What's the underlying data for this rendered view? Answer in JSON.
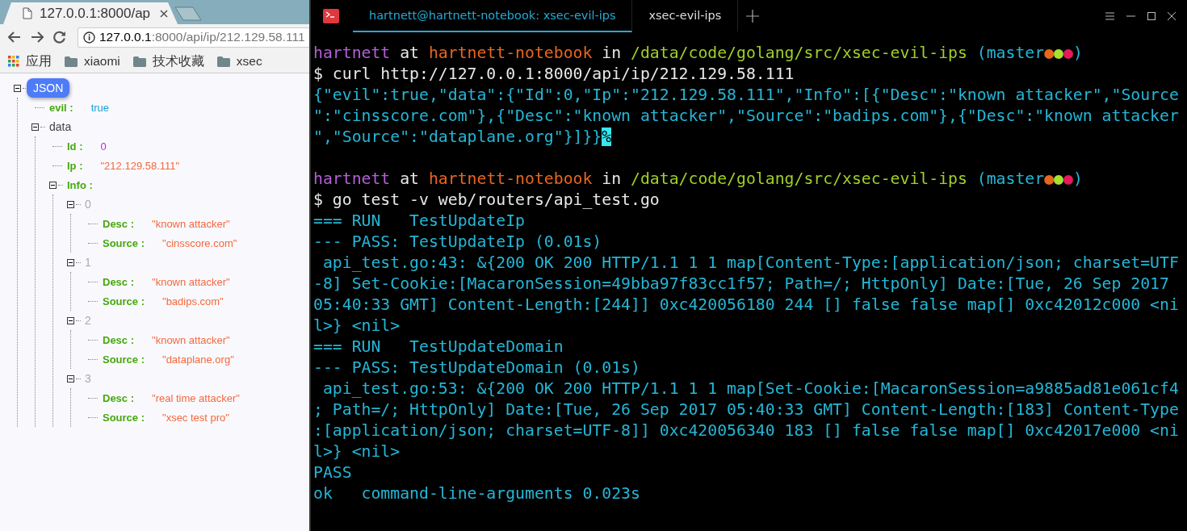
{
  "browser": {
    "tabs": [
      {
        "title": "127.0.0.1:8000/ap",
        "selected": true
      }
    ],
    "address": {
      "host": "127.0.0.1",
      "path": ":8000/api/ip/212.129.58.111"
    },
    "bookmarks": [
      {
        "label": "应用",
        "kind": "apps"
      },
      {
        "label": "xiaomi",
        "kind": "folder"
      },
      {
        "label": "技术收藏",
        "kind": "folder"
      },
      {
        "label": "xsec",
        "kind": "folder"
      }
    ],
    "tree": {
      "root": "JSON",
      "expanded": true,
      "children": [
        {
          "label": "evil :",
          "kind": "boolean",
          "value": "true"
        },
        {
          "label": "data",
          "kind": "object",
          "expanded": true,
          "children": [
            {
              "label": "Id :",
              "kind": "number",
              "value": "0"
            },
            {
              "label": "Ip :",
              "kind": "string",
              "value": "\"212.129.58.111\""
            },
            {
              "label": "Info :",
              "kind": "array",
              "expanded": true,
              "children": [
                {
                  "label": "0",
                  "kind": "index",
                  "expanded": true,
                  "children": [
                    {
                      "label": "Desc :",
                      "kind": "string",
                      "value": "\"known attacker\""
                    },
                    {
                      "label": "Source :",
                      "kind": "string",
                      "value": "\"cinsscore.com\""
                    }
                  ]
                },
                {
                  "label": "1",
                  "kind": "index",
                  "expanded": true,
                  "children": [
                    {
                      "label": "Desc :",
                      "kind": "string",
                      "value": "\"known attacker\""
                    },
                    {
                      "label": "Source :",
                      "kind": "string",
                      "value": "\"badips.com\""
                    }
                  ]
                },
                {
                  "label": "2",
                  "kind": "index",
                  "expanded": true,
                  "children": [
                    {
                      "label": "Desc :",
                      "kind": "string",
                      "value": "\"known attacker\""
                    },
                    {
                      "label": "Source :",
                      "kind": "string",
                      "value": "\"dataplane.org\""
                    }
                  ]
                },
                {
                  "label": "3",
                  "kind": "index",
                  "expanded": true,
                  "children": [
                    {
                      "label": "Desc :",
                      "kind": "string",
                      "value": "\"real time attacker\""
                    },
                    {
                      "label": "Source :",
                      "kind": "string",
                      "value": "\"xsec test pro\""
                    }
                  ]
                }
              ]
            }
          ]
        }
      ]
    }
  },
  "terminal": {
    "tabs": [
      {
        "title": "hartnett@hartnett-notebook: xsec-evil-ips",
        "selected": true
      },
      {
        "title": "xsec-evil-ips",
        "selected": false
      }
    ],
    "lines": [
      {
        "kind": "text",
        "segments": [
          {
            "text": "hartnett",
            "kind": "user"
          },
          {
            "text": " at ",
            "kind": "plain"
          },
          {
            "text": "hartnett-notebook",
            "kind": "host"
          },
          {
            "text": " in ",
            "kind": "plain"
          },
          {
            "text": "/data/code/golang/src/xsec-evil-ips",
            "kind": "path"
          },
          {
            "text": " (master",
            "kind": "branch"
          },
          {
            "text": "●",
            "kind": "dot",
            "color": "#e8661e"
          },
          {
            "text": "●",
            "kind": "dot",
            "color": "#a6e22e"
          },
          {
            "text": "●",
            "kind": "dot",
            "color": "#e5195c"
          },
          {
            "text": ")",
            "kind": "branch"
          }
        ]
      },
      {
        "kind": "text",
        "segments": [
          {
            "text": "$ curl http://127.0.0.1:8000/api/ip/212.129.58.111",
            "kind": "command"
          }
        ]
      },
      {
        "kind": "text",
        "segments": [
          {
            "text": "{\"evil\":true,\"data\":{\"Id\":0,\"Ip\":\"212.129.58.111\",\"Info\":[{\"Desc\":\"known attacker\",\"Source",
            "kind": "output"
          }
        ]
      },
      {
        "kind": "text",
        "segments": [
          {
            "text": "\":\"cinsscore.com\"},{\"Desc\":\"known attacker\",\"Source\":\"badips.com\"},{\"Desc\":\"known attacker",
            "kind": "output"
          }
        ]
      },
      {
        "kind": "text",
        "segments": [
          {
            "text": "\",\"Source\":\"dataplane.org\"}]}}",
            "kind": "output"
          },
          {
            "text": "%",
            "kind": "cursor"
          }
        ]
      },
      {
        "kind": "blank"
      },
      {
        "kind": "text",
        "segments": [
          {
            "text": "hartnett",
            "kind": "user"
          },
          {
            "text": " at ",
            "kind": "plain"
          },
          {
            "text": "hartnett-notebook",
            "kind": "host"
          },
          {
            "text": " in ",
            "kind": "plain"
          },
          {
            "text": "/data/code/golang/src/xsec-evil-ips",
            "kind": "path"
          },
          {
            "text": " (master",
            "kind": "branch"
          },
          {
            "text": "●",
            "kind": "dot",
            "color": "#e8661e"
          },
          {
            "text": "●",
            "kind": "dot",
            "color": "#a6e22e"
          },
          {
            "text": "●",
            "kind": "dot",
            "color": "#e5195c"
          },
          {
            "text": ")",
            "kind": "branch"
          }
        ]
      },
      {
        "kind": "text",
        "segments": [
          {
            "text": "$ go test -v web/routers/api_test.go",
            "kind": "command"
          }
        ]
      },
      {
        "kind": "text",
        "segments": [
          {
            "text": "=== RUN   TestUpdateIp",
            "kind": "output"
          }
        ]
      },
      {
        "kind": "text",
        "segments": [
          {
            "text": "--- PASS: TestUpdateIp (0.01s)",
            "kind": "output"
          }
        ]
      },
      {
        "kind": "text",
        "segments": [
          {
            "text": " api_test.go:43: &{200 OK 200 HTTP/1.1 1 1 map[Content-Type:[application/json; charset=UTF",
            "kind": "output"
          }
        ]
      },
      {
        "kind": "text",
        "segments": [
          {
            "text": "-8] Set-Cookie:[MacaronSession=49bba97f83cc1f57; Path=/; HttpOnly] Date:[Tue, 26 Sep 2017",
            "kind": "output"
          }
        ]
      },
      {
        "kind": "text",
        "segments": [
          {
            "text": "05:40:33 GMT] Content-Length:[244]] 0xc420056180 244 [] false false map[] 0xc42012c000 <ni",
            "kind": "output"
          }
        ]
      },
      {
        "kind": "text",
        "segments": [
          {
            "text": "l>} <nil>",
            "kind": "output"
          }
        ]
      },
      {
        "kind": "text",
        "segments": [
          {
            "text": "=== RUN   TestUpdateDomain",
            "kind": "output"
          }
        ]
      },
      {
        "kind": "text",
        "segments": [
          {
            "text": "--- PASS: TestUpdateDomain (0.01s)",
            "kind": "output"
          }
        ]
      },
      {
        "kind": "text",
        "segments": [
          {
            "text": " api_test.go:53: &{200 OK 200 HTTP/1.1 1 1 map[Set-Cookie:[MacaronSession=a9885ad81e061cf4",
            "kind": "output"
          }
        ]
      },
      {
        "kind": "text",
        "segments": [
          {
            "text": "; Path=/; HttpOnly] Date:[Tue, 26 Sep 2017 05:40:33 GMT] Content-Length:[183] Content-Type",
            "kind": "output"
          }
        ]
      },
      {
        "kind": "text",
        "segments": [
          {
            "text": ":[application/json; charset=UTF-8]] 0xc420056340 183 [] false false map[] 0xc42017e000 <ni",
            "kind": "output"
          }
        ]
      },
      {
        "kind": "text",
        "segments": [
          {
            "text": "l>} <nil>",
            "kind": "output"
          }
        ]
      },
      {
        "kind": "text",
        "segments": [
          {
            "text": "PASS",
            "kind": "output"
          }
        ]
      },
      {
        "kind": "text",
        "segments": [
          {
            "text": "ok   command-line-arguments 0.023s",
            "kind": "output"
          }
        ]
      }
    ]
  }
}
